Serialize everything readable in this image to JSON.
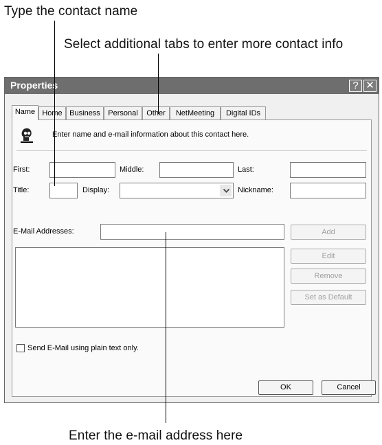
{
  "callouts": {
    "top1": "Type the contact name",
    "top2": "Select additional tabs to enter more contact info",
    "bottom": "Enter the e-mail address here"
  },
  "dialog": {
    "title": "Properties",
    "help_label": "?",
    "close_label": "✕",
    "tabs": [
      "Name",
      "Home",
      "Business",
      "Personal",
      "Other",
      "NetMeeting",
      "Digital IDs"
    ],
    "active_tab": "Name",
    "description": "Enter name and e-mail information about this contact here.",
    "labels": {
      "first": "First:",
      "middle": "Middle:",
      "last": "Last:",
      "title": "Title:",
      "display": "Display:",
      "nickname": "Nickname:",
      "email": "E-Mail Addresses:"
    },
    "values": {
      "first": "",
      "middle": "",
      "last": "",
      "title": "",
      "display": "",
      "nickname": "",
      "email": ""
    },
    "buttons": {
      "add": "Add",
      "edit": "Edit",
      "remove": "Remove",
      "set_default": "Set as Default",
      "ok": "OK",
      "cancel": "Cancel"
    },
    "plain_text_label": "Send E-Mail using plain text only.",
    "plain_text_checked": false,
    "icons": [
      "contact-head-icon",
      "dropdown-arrow-icon",
      "help-icon",
      "close-icon"
    ]
  }
}
